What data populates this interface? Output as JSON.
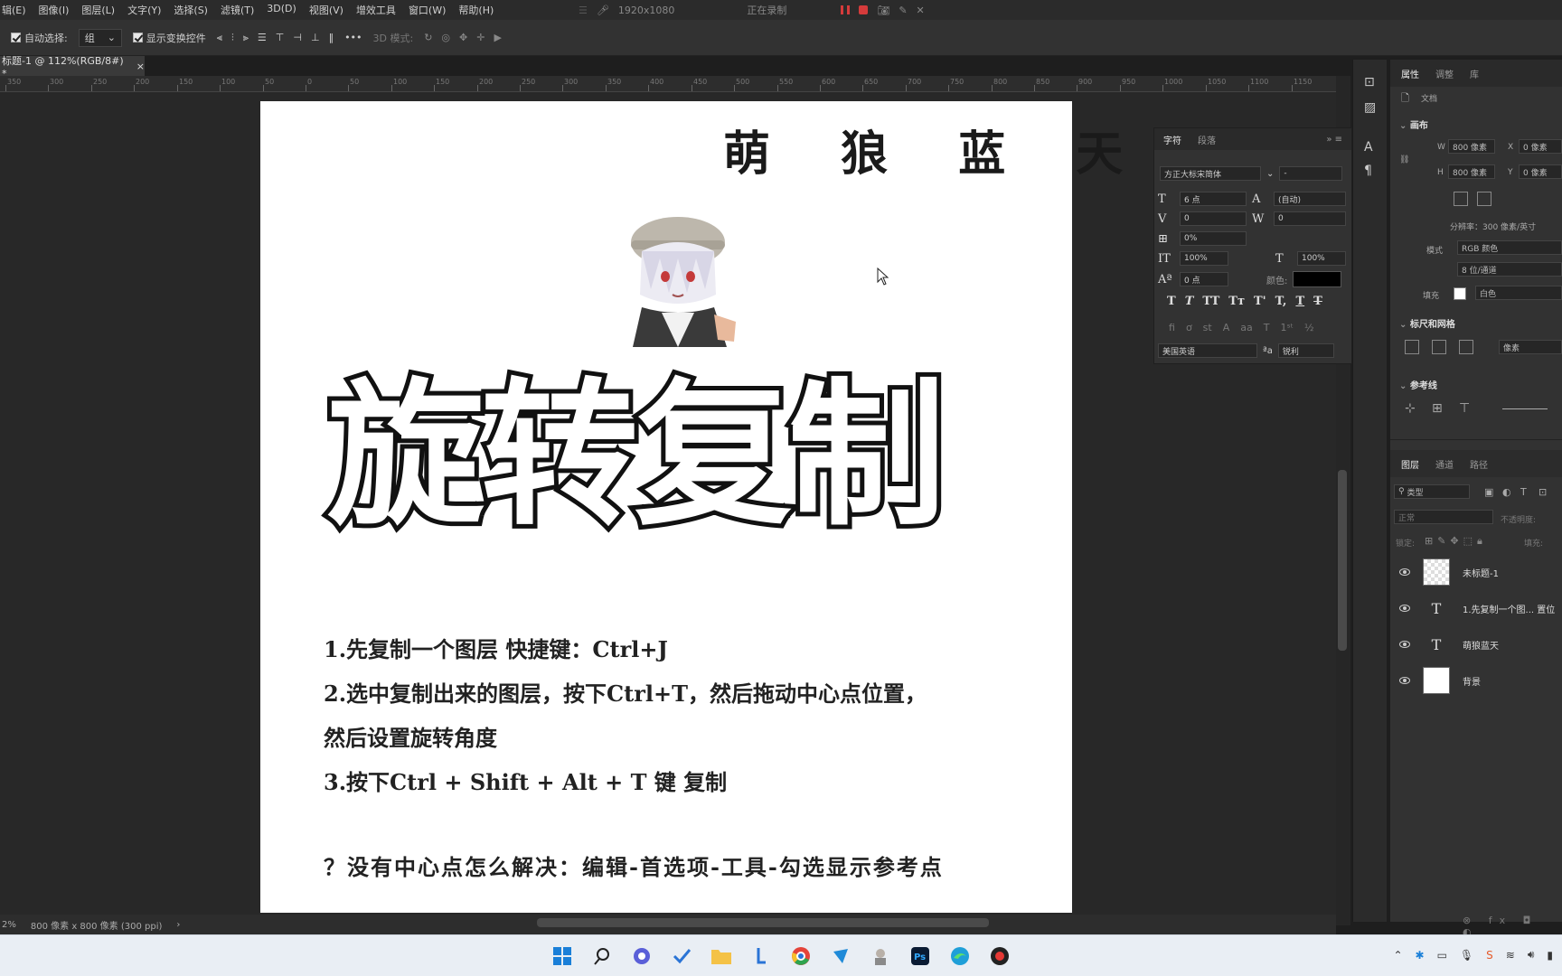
{
  "menubar": {
    "items": [
      "辑(E)",
      "图像(I)",
      "图层(L)",
      "文字(Y)",
      "选择(S)",
      "滤镜(T)",
      "3D(D)",
      "视图(V)",
      "增效工具",
      "窗口(W)",
      "帮助(H)"
    ],
    "recording": {
      "resolution": "1920x1080",
      "status": "正在录制"
    }
  },
  "options": {
    "auto_select_label": "自动选择:",
    "auto_select_value": "组",
    "show_transform_label": "显示变换控件",
    "mode_3d_label": "3D 模式:",
    "more_label": "•••"
  },
  "document": {
    "tab_title": "标题-1 @ 112%(RGB/8#) *",
    "brand": "萌 狼 蓝 天",
    "title": "旋转复制",
    "steps": [
      "1.先复制一个图层  快捷键：Ctrl+J",
      "2.选中复制出来的图层，按下Ctrl+T，然后拖动中心点位置，",
      "然后设置旋转角度",
      "3.按下Ctrl + Shift + Alt + T 键 复制"
    ],
    "note": "？没有中心点怎么解决：编辑-首选项-工具-勾选显示参考点"
  },
  "ruler": {
    "ticks": [
      "350",
      "300",
      "250",
      "200",
      "150",
      "100",
      "50",
      "0",
      "50",
      "100",
      "150",
      "200",
      "250",
      "300",
      "350",
      "400",
      "450",
      "500",
      "550",
      "600",
      "650",
      "700",
      "750",
      "800",
      "850",
      "900",
      "950",
      "1000",
      "1050",
      "1100",
      "1150"
    ]
  },
  "status": {
    "zoom": "2%",
    "size": "800 像素 x 800 像素 (300 ppi)"
  },
  "character_panel": {
    "tab_character": "字符",
    "tab_paragraph": "段落",
    "font_family": "方正大标宋简体",
    "font_style": "-",
    "font_size": "6 点",
    "leading": "(自动)",
    "kerning": "0",
    "tracking": "0",
    "scale_pct": "0%",
    "vscale": "100%",
    "hscale": "100%",
    "baseline": "0 点",
    "color_label": "颜色:",
    "language": "美国英语",
    "antialias": "锐利"
  },
  "properties": {
    "tab_properties": "属性",
    "tab_adjust": "调整",
    "tab_library": "库",
    "doc_label": "文档",
    "canvas_section": "画布",
    "w_label": "W",
    "w_value": "800 像素",
    "h_label": "H",
    "h_value": "800 像素",
    "x_label": "X",
    "x_value": "0 像素",
    "y_label": "Y",
    "y_value": "0 像素",
    "resolution": "分辨率：300 像素/英寸",
    "mode_label": "模式",
    "mode_value": "RGB 颜色",
    "depth_value": "8 位/通道",
    "fill_label": "填充",
    "fill_value": "白色",
    "rulers_section": "标尺和网格",
    "units_value": "像素",
    "guides_section": "参考线"
  },
  "layers": {
    "tab_layers": "图层",
    "tab_channels": "通道",
    "tab_paths": "路径",
    "filter_label": "类型",
    "blend_mode": "正常",
    "opacity_label": "不透明度:",
    "lock_label": "锁定:",
    "fill_label": "填充:",
    "items": [
      {
        "name": "未标题-1",
        "kind": "image"
      },
      {
        "name": "1.先复制一个图... 置位",
        "kind": "text"
      },
      {
        "name": "萌狼蓝天",
        "kind": "text"
      },
      {
        "name": "背景",
        "kind": "background"
      }
    ]
  }
}
